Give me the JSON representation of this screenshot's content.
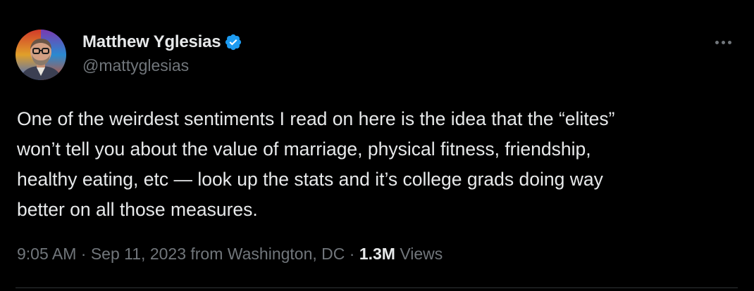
{
  "author": {
    "display_name": "Matthew Yglesias",
    "handle": "@mattyglesias",
    "verified_icon": "verified-badge-icon",
    "verified_color": "#1d9bf0"
  },
  "tweet": {
    "lines": [
      "One of the weirdest sentiments I read on here is the idea that the “elites”",
      "won’t tell you about the value of marriage, physical fitness, friendship,",
      "healthy eating, etc — look up the stats and it’s college grads doing way",
      "better on all those measures."
    ]
  },
  "meta": {
    "time": "9:05 AM",
    "separator": "·",
    "date": "Sep 11, 2023",
    "location": "from Washington, DC",
    "views_count": "1.3M",
    "views_label": "Views"
  },
  "menu": {
    "icon": "more-horizontal-icon"
  },
  "colors": {
    "background": "#000000",
    "primary_text": "#e7e9ea",
    "secondary_text": "#71767b",
    "accent": "#1d9bf0"
  }
}
